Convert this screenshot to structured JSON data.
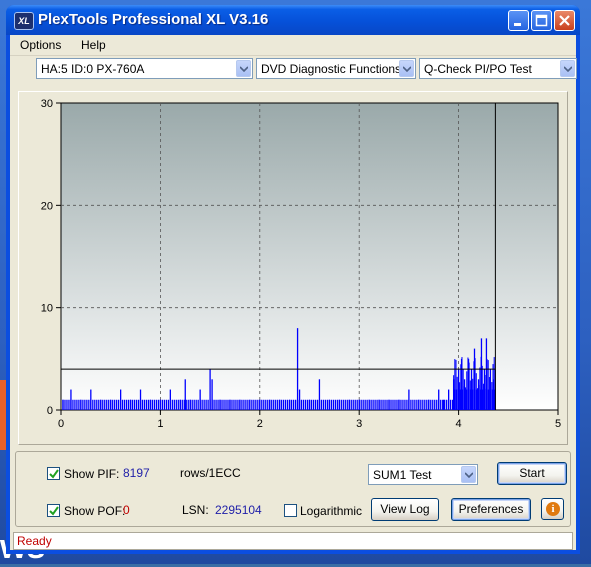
{
  "window": {
    "title": "PlexTools Professional XL V3.16",
    "icon_text": "XL"
  },
  "desktop": {
    "text": "ws"
  },
  "menu": {
    "options": "Options",
    "help": "Help"
  },
  "toolbar": {
    "drive": "HA:5 ID:0  PX-760A",
    "function": "DVD Diagnostic Functions",
    "test": "Q-Check PI/PO Test"
  },
  "chart_data": {
    "type": "bar",
    "x_ticks": [
      "0",
      "1",
      "2",
      "3",
      "4",
      "5"
    ],
    "y_ticks": [
      "0",
      "10",
      "20",
      "30"
    ],
    "xlim": [
      0,
      5
    ],
    "ylim": [
      0,
      30
    ],
    "threshold": 4,
    "end_marker_x": 4.37,
    "grid": true,
    "series_color": "#0000ff",
    "values_approx": [
      [
        0.02,
        1
      ],
      [
        0.1,
        2
      ],
      [
        0.2,
        1
      ],
      [
        0.3,
        2
      ],
      [
        0.4,
        1
      ],
      [
        0.5,
        1
      ],
      [
        0.6,
        2
      ],
      [
        0.7,
        1
      ],
      [
        0.8,
        2
      ],
      [
        0.9,
        1
      ],
      [
        1.0,
        1
      ],
      [
        1.1,
        2
      ],
      [
        1.2,
        1
      ],
      [
        1.25,
        3
      ],
      [
        1.3,
        1
      ],
      [
        1.4,
        2
      ],
      [
        1.5,
        4
      ],
      [
        1.52,
        3
      ],
      [
        1.6,
        1
      ],
      [
        1.7,
        1
      ],
      [
        1.8,
        1
      ],
      [
        1.9,
        1
      ],
      [
        2.0,
        1
      ],
      [
        2.1,
        1
      ],
      [
        2.2,
        1
      ],
      [
        2.3,
        1
      ],
      [
        2.38,
        8
      ],
      [
        2.4,
        2
      ],
      [
        2.5,
        1
      ],
      [
        2.6,
        3
      ],
      [
        2.7,
        1
      ],
      [
        2.8,
        1
      ],
      [
        2.9,
        1
      ],
      [
        3.0,
        1
      ],
      [
        3.1,
        1
      ],
      [
        3.2,
        1
      ],
      [
        3.3,
        1
      ],
      [
        3.4,
        1
      ],
      [
        3.5,
        2
      ],
      [
        3.6,
        1
      ],
      [
        3.7,
        1
      ],
      [
        3.8,
        2
      ],
      [
        3.85,
        1
      ],
      [
        3.9,
        2
      ],
      [
        3.95,
        3
      ],
      [
        4.0,
        4
      ],
      [
        4.03,
        5
      ],
      [
        4.06,
        3
      ],
      [
        4.1,
        5
      ],
      [
        4.13,
        4
      ],
      [
        4.16,
        6
      ],
      [
        4.2,
        3
      ],
      [
        4.23,
        7
      ],
      [
        4.26,
        4
      ],
      [
        4.28,
        7
      ],
      [
        4.32,
        4
      ],
      [
        4.35,
        3
      ]
    ]
  },
  "controls": {
    "show_pif_label": "Show PIF:",
    "pif_value": "8197",
    "pif_unit": "rows/1ECC",
    "show_pof_label": "Show POF:",
    "pof_value": "0",
    "lsn_label": "LSN:",
    "lsn_value": "2295104",
    "logarithmic_label": "Logarithmic",
    "sum_test": "SUM1 Test",
    "start_button": "Start",
    "view_log_button": "View Log",
    "preferences_button": "Preferences",
    "show_pif_checked": true,
    "show_pof_checked": true,
    "logarithmic_checked": false
  },
  "status": {
    "text": "Ready"
  }
}
